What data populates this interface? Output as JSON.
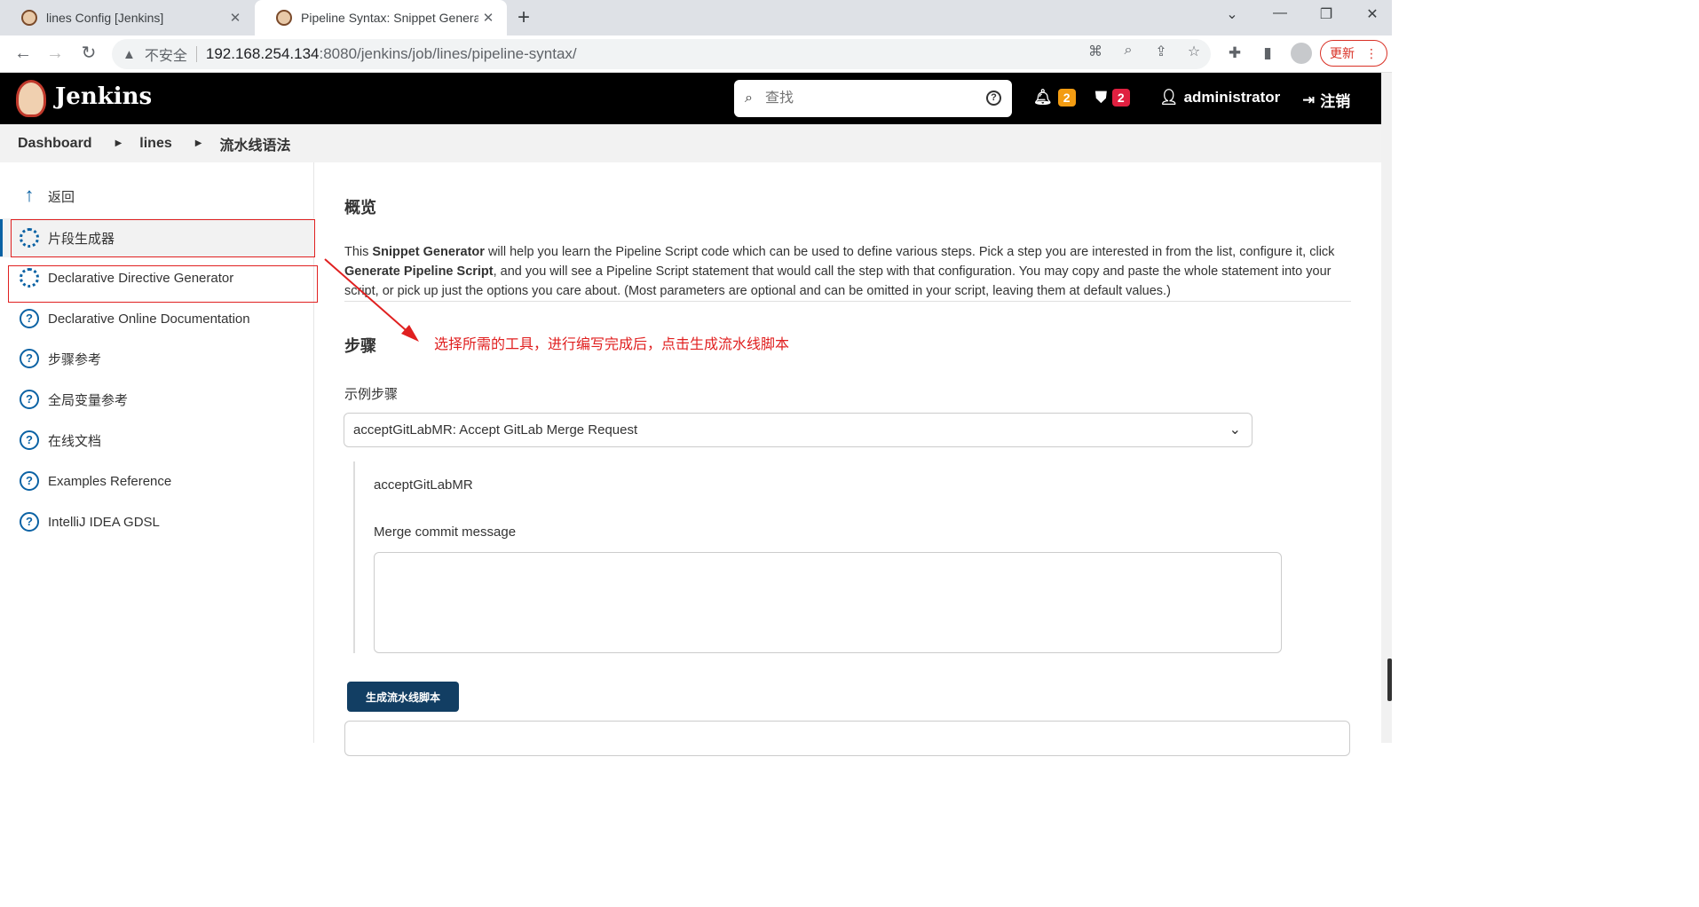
{
  "browser": {
    "tabs": [
      {
        "title": "lines Config [Jenkins]"
      },
      {
        "title": "Pipeline Syntax: Snippet Generator"
      }
    ],
    "insecure_label": "不安全",
    "url_host": "192.168.254.134",
    "url_rest": ":8080/jenkins/job/lines/pipeline-syntax/",
    "update_label": "更新"
  },
  "header": {
    "title": "Jenkins",
    "search_placeholder": "查找",
    "notifications_count": "2",
    "security_count": "2",
    "user": "administrator",
    "logout": "注销"
  },
  "breadcrumb": [
    "Dashboard",
    "lines",
    "流水线语法"
  ],
  "sidebar": {
    "items": [
      {
        "label": "返回"
      },
      {
        "label": "片段生成器"
      },
      {
        "label": "Declarative Directive Generator"
      },
      {
        "label": "Declarative Online Documentation"
      },
      {
        "label": "步骤参考"
      },
      {
        "label": "全局变量参考"
      },
      {
        "label": "在线文档"
      },
      {
        "label": "Examples Reference"
      },
      {
        "label": "IntelliJ IDEA GDSL"
      }
    ]
  },
  "main": {
    "overview_title": "概览",
    "intro_p1": "This ",
    "intro_b1": "Snippet Generator",
    "intro_p2": " will help you learn the Pipeline Script code which can be used to define various steps. Pick a step you are interested in from the list, configure it, click ",
    "intro_b2": "Generate Pipeline Script",
    "intro_p3": ", and you will see a Pipeline Script statement that would call the step with that configuration. You may copy and paste the whole statement into your script, or pick up just the options you care about. (Most parameters are optional and can be omitted in your script, leaving them at default values.)",
    "steps_title": "步骤",
    "annotation": "选择所需的工具，进行编写完成后，点击生成流水线脚本",
    "sample_step_label": "示例步骤",
    "sample_step_value": "acceptGitLabMR: Accept GitLab Merge Request",
    "step_name": "acceptGitLabMR",
    "merge_commit_label": "Merge commit message",
    "merge_commit_value": "",
    "generate_button": "生成流水线脚本"
  },
  "colors": {
    "header_bg": "#000000",
    "accent_blue": "#0b62a4",
    "button_bg": "#123e63",
    "annotation_red": "#e02020",
    "badge_orange": "#f39c12",
    "badge_red": "#e02040"
  }
}
